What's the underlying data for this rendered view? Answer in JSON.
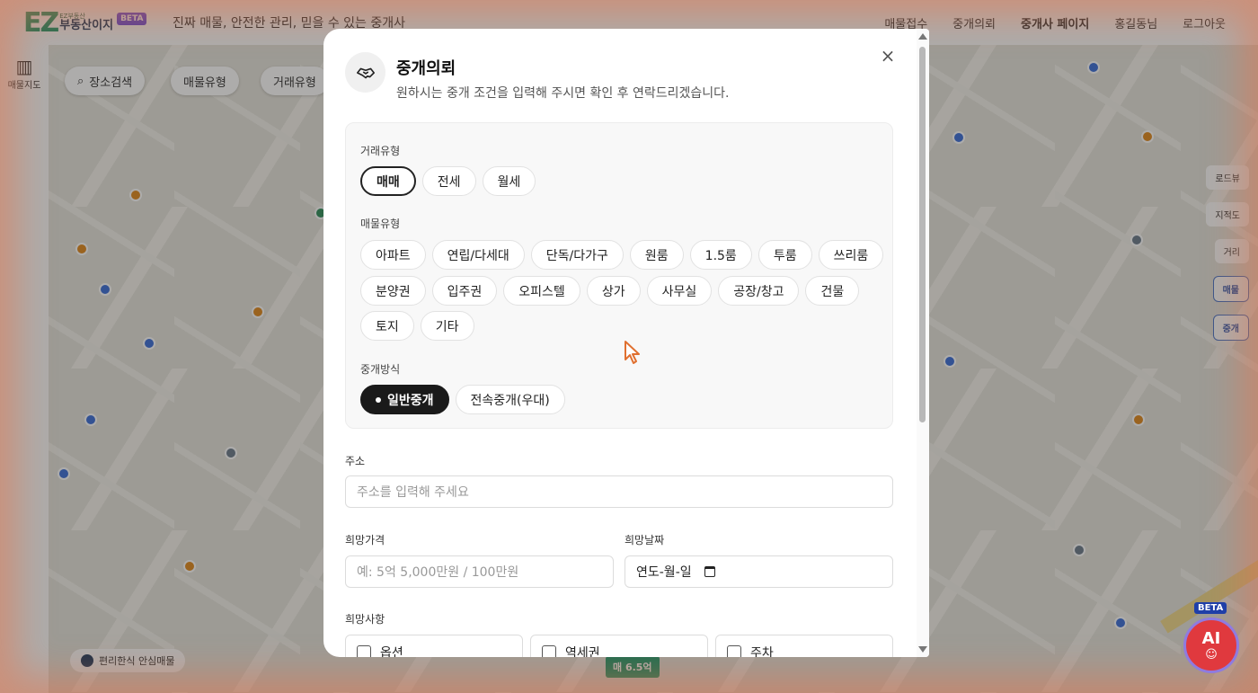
{
  "background": {
    "logo": {
      "small": "EZ부동산",
      "name": "부동산이지",
      "beta": "BETA"
    },
    "tagline": "진짜 매물, 안전한 관리, 믿을 수 있는 중개사",
    "nav": [
      "매물접수",
      "중개의뢰",
      "중개사 페이지",
      "홍길동님",
      "로그아웃"
    ],
    "rail": [
      {
        "label": "매물지도",
        "icon": "map-icon"
      }
    ],
    "map_pills": [
      "장소검색",
      "매물유형",
      "거래유형"
    ],
    "right_tools": [
      "로드뷰",
      "지적도",
      "거리",
      "매물",
      "중개"
    ],
    "bottom_chip": "편리한식 안심매물",
    "price_tag": "매 6.5억"
  },
  "modal": {
    "title": "중개의뢰",
    "subtitle": "원하시는 중개 조건을 입력해 주시면 확인 후 연락드리겠습니다.",
    "deal_type": {
      "label": "거래유형",
      "options": [
        "매매",
        "전세",
        "월세"
      ],
      "selected": "매매"
    },
    "property_type": {
      "label": "매물유형",
      "rows": [
        [
          "아파트",
          "연립/다세대",
          "단독/다가구",
          "원룸",
          "1.5룸",
          "투룸",
          "쓰리룸"
        ],
        [
          "분양권",
          "입주권",
          "오피스텔",
          "상가",
          "사무실",
          "공장/창고",
          "건물"
        ],
        [
          "토지",
          "기타"
        ]
      ]
    },
    "brokerage": {
      "label": "중개방식",
      "options": [
        "일반중개",
        "전속중개(우대)"
      ],
      "selected": "일반중개"
    },
    "address": {
      "label": "주소",
      "placeholder": "주소를 입력해 주세요"
    },
    "price": {
      "label": "희망가격",
      "placeholder": "예: 5억 5,000만원 / 100만원"
    },
    "date": {
      "label": "희망날짜",
      "value": "연도-월-일"
    },
    "wishes": {
      "label": "희망사항",
      "options": [
        "옵션",
        "역세권",
        "주차"
      ]
    }
  },
  "ai_button": {
    "beta": "BETA",
    "label": "AI"
  }
}
